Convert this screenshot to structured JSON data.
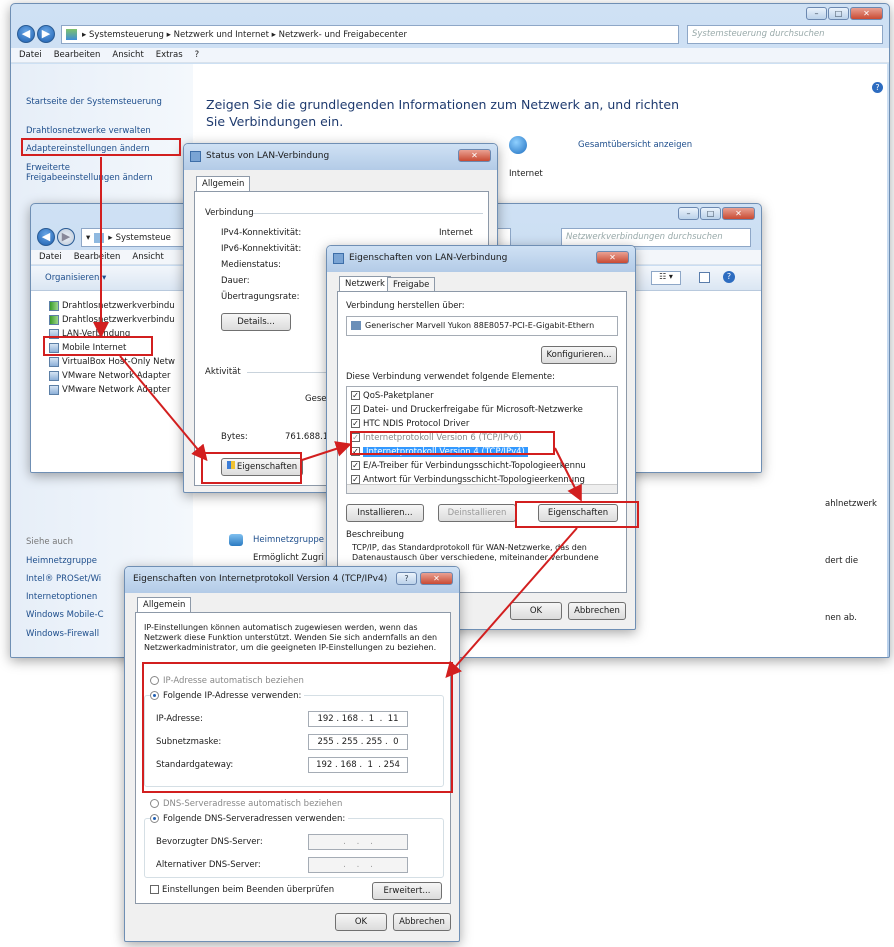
{
  "main": {
    "breadcrumb": [
      "Systemsteuerung",
      "Netzwerk und Internet",
      "Netzwerk- und Freigabecenter"
    ],
    "search_placeholder": "Systemsteuerung durchsuchen",
    "menu": [
      "Datei",
      "Bearbeiten",
      "Ansicht",
      "Extras",
      "?"
    ],
    "sidebar": [
      "Startseite der Systemsteuerung",
      "Drahtlosnetzwerke verwalten",
      "Adaptereinstellungen ändern",
      "Erweiterte",
      "Freigabeeinstellungen ändern"
    ],
    "see_also_header": "Siehe auch",
    "see_also": [
      "Heimnetzgruppe",
      "Intel® PROSet/Wi",
      "Internetoptionen",
      "Windows Mobile-C",
      "Windows-Firewall"
    ],
    "heading": "Zeigen Sie die grundlegenden Informationen zum Netzwerk an, und richten Sie Verbindungen ein.",
    "overview_link": "Gesamtübersicht anzeigen",
    "internet_label": "Internet",
    "right_texts": [
      "ahlnetzwerk",
      "dert die",
      "nen ab."
    ],
    "heimnetz_title": "Heimnetzgruppe",
    "heimnetz_desc": "Ermöglicht Zugri"
  },
  "adapters": {
    "breadcrumb": "Systemsteue",
    "search_placeholder": "Netzwerkverbindungen durchsuchen",
    "menu": [
      "Datei",
      "Bearbeiten",
      "Ansicht"
    ],
    "organize": "Organisieren ▾",
    "items": [
      "Drahtlosnetzwerkverbindu",
      "Drahtlosnetzwerkverbindu",
      "LAN-Verbindung",
      "Mobile Internet",
      "VirtualBox Host-Only Netw",
      "VMware Network Adapter",
      "VMware Network Adapter"
    ]
  },
  "status": {
    "title": "Status von LAN-Verbindung",
    "tab": "Allgemein",
    "connection_header": "Verbindung",
    "rows": [
      {
        "label": "IPv4-Konnektivität:",
        "value": "Internet"
      },
      {
        "label": "IPv6-Konnektivität:",
        "value": ""
      },
      {
        "label": "Medienstatus:",
        "value": ""
      },
      {
        "label": "Dauer:",
        "value": ""
      },
      {
        "label": "Übertragungsrate:",
        "value": ""
      }
    ],
    "details_button": "Details...",
    "activity_header": "Aktivität",
    "sent_label": "Gesendet",
    "bytes_label": "Bytes:",
    "bytes_value": "761.688.154",
    "properties_button": "Eigenschaften"
  },
  "lanprops": {
    "title": "Eigenschaften von LAN-Verbindung",
    "tabs": [
      "Netzwerk",
      "Freigabe"
    ],
    "connect_using_label": "Verbindung herstellen über:",
    "adapter_name": "Generischer Marvell Yukon 88E8057-PCI-E-Gigabit-Ethern",
    "configure_button": "Konfigurieren...",
    "items_label": "Diese Verbindung verwendet folgende Elemente:",
    "items": [
      "QoS-Paketplaner",
      "Datei- und Druckerfreigabe für Microsoft-Netzwerke",
      "HTC NDIS Protocol Driver",
      "Internetprotokoll Version 6 (TCP/IPv6)",
      "Internetprotokoll Version 4 (TCP/IPv4)",
      "E/A-Treiber für Verbindungsschicht-Topologieerkennu",
      "Antwort für Verbindungsschicht-Topologieerkennung"
    ],
    "install_button": "Installieren...",
    "uninstall_button": "Deinstallieren",
    "properties_button": "Eigenschaften",
    "description_label": "Beschreibung",
    "description_text": "TCP/IP, das Standardprotokoll für WAN-Netzwerke, das den Datenaustausch über verschiedene, miteinander verbundene",
    "ok_button": "OK",
    "cancel_button": "Abbrechen"
  },
  "ipv4": {
    "title": "Eigenschaften von Internetprotokoll Version 4 (TCP/IPv4)",
    "tab": "Allgemein",
    "intro": "IP-Einstellungen können automatisch zugewiesen werden, wenn das Netzwerk diese Funktion unterstützt. Wenden Sie sich andernfalls an den Netzwerkadministrator, um die geeigneten IP-Einstellungen zu beziehen.",
    "auto_ip": "IP-Adresse automatisch beziehen",
    "manual_ip": "Folgende IP-Adresse verwenden:",
    "ip_label": "IP-Adresse:",
    "ip_value": "192 . 168 .  1  .  11",
    "mask_label": "Subnetzmaske:",
    "mask_value": "255 . 255 . 255 .  0",
    "gateway_label": "Standardgateway:",
    "gateway_value": "192 . 168 .  1  . 254",
    "auto_dns": "DNS-Serveradresse automatisch beziehen",
    "manual_dns": "Folgende DNS-Serveradressen verwenden:",
    "pref_dns_label": "Bevorzugter DNS-Server:",
    "alt_dns_label": "Alternativer DNS-Server:",
    "empty_ip": "  .    .    .  ",
    "validate_label": "Einstellungen beim Beenden überprüfen",
    "advanced_button": "Erweitert...",
    "ok_button": "OK",
    "cancel_button": "Abbrechen"
  }
}
